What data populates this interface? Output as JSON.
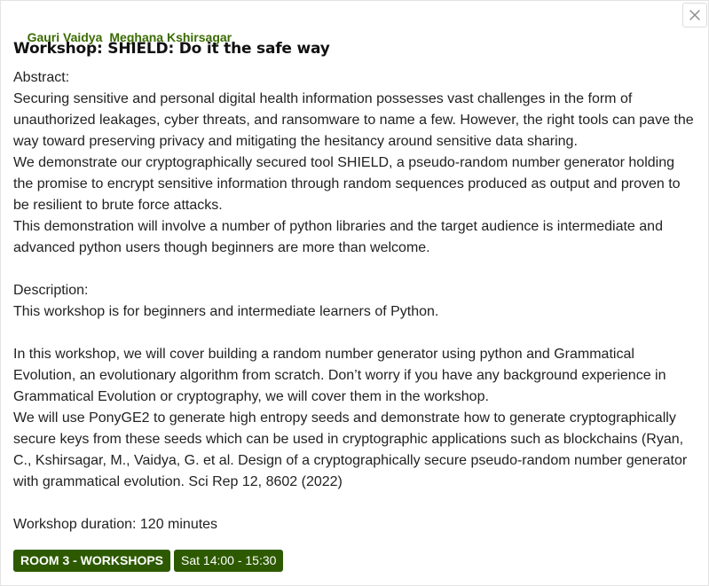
{
  "speakers": [
    "Gauri Vaidya",
    "Meghana Kshirsagar"
  ],
  "title": "Workshop: SHIELD: Do it the safe way",
  "close_icon": "close-icon",
  "abstract": {
    "heading": "Abstract:",
    "paragraphs": [
      "Securing sensitive and personal digital health information possesses vast challenges in the form of unauthorized leakages, cyber threats, and ransomware to name a few. However, the right tools can pave the way toward preserving privacy and mitigating the hesitancy around sensitive data sharing.",
      "We demonstrate our cryptographically secured tool SHIELD, a pseudo-random number generator holding the promise to encrypt sensitive information through random sequences produced as output and proven to be resilient to brute force attacks.",
      "This demonstration will involve a number of python libraries and the target audience is intermediate and advanced python users though beginners are more than welcome."
    ]
  },
  "description": {
    "heading": "Description:",
    "intro": "This workshop is for beginners and intermediate learners of Python.",
    "paragraphs": [
      "In this workshop, we will cover building a random number generator using python and Grammatical Evolution, an evolutionary algorithm from scratch. Don’t worry if you have any background experience in Grammatical Evolution or cryptography, we will cover them in the workshop.",
      "We will use PonyGE2 to generate high entropy seeds and demonstrate how to generate cryptographically secure keys from these seeds which can be used in cryptographic applications such as blockchains (Ryan, C., Kshirsagar, M., Vaidya, G. et al. Design of a cryptographically secure pseudo-random number generator with grammatical evolution. Sci Rep 12, 8602 (2022)"
    ]
  },
  "duration": "Workshop duration: 120 minutes",
  "tags": {
    "room": "ROOM 3 - WORKSHOPS",
    "time": "Sat 14:00 - 15:30"
  },
  "colors": {
    "speaker_text": "#3a6b00",
    "tag_background": "#2d5a00",
    "tag_text": "#ffffff"
  }
}
